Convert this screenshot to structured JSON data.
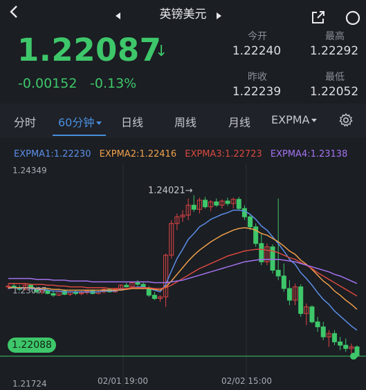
{
  "header": {
    "title": "英镑美元"
  },
  "quote": {
    "price": "1.22087",
    "arrow": "↓",
    "change": "-0.00152",
    "change_pct": "-0.13%"
  },
  "stats": {
    "open_label": "今开",
    "open_value": "1.22240",
    "high_label": "最高",
    "high_value": "1.22292",
    "prev_close_label": "昨收",
    "prev_close_value": "1.22239",
    "low_label": "最低",
    "low_value": "1.22052"
  },
  "tabs": {
    "t1": "分时",
    "t2": "60分钟",
    "t3": "日线",
    "t4": "周线",
    "t5": "月线",
    "t6": "EXPMA"
  },
  "legend": {
    "e1": "EXPMA1:1.22230",
    "e2": "EXPMA2:1.22416",
    "e3": "EXPMA3:1.22723",
    "e4": "EXPMA4:1.23138"
  },
  "axis": {
    "y_top": "1.24349",
    "y_mid": "1.23037",
    "y_bottom": "1.21724",
    "x1": "02/01 19:00",
    "x2": "02/02 15:00",
    "current": "1.22088",
    "high_annotation": "1.24021→"
  },
  "colors": {
    "up": "#e04545",
    "down": "#3ec76a",
    "ema1": "#5c8fe8",
    "ema2": "#f0a04b",
    "ema3": "#d9493f",
    "ema4": "#a473f0"
  },
  "chart_data": {
    "type": "candlestick",
    "ylim": [
      1.21724,
      1.24349
    ],
    "candles": [
      [
        1.2292,
        1.2296,
        1.2289,
        1.2293
      ],
      [
        1.2293,
        1.2297,
        1.229,
        1.2291
      ],
      [
        1.2291,
        1.2294,
        1.2287,
        1.2289
      ],
      [
        1.2289,
        1.2295,
        1.2288,
        1.2294
      ],
      [
        1.2294,
        1.2296,
        1.2289,
        1.229
      ],
      [
        1.229,
        1.2292,
        1.2285,
        1.2286
      ],
      [
        1.2286,
        1.229,
        1.2283,
        1.2288
      ],
      [
        1.2288,
        1.229,
        1.2283,
        1.2284
      ],
      [
        1.2284,
        1.2287,
        1.228,
        1.2282
      ],
      [
        1.2282,
        1.2288,
        1.2281,
        1.2287
      ],
      [
        1.2287,
        1.2289,
        1.2282,
        1.2283
      ],
      [
        1.2283,
        1.2287,
        1.2281,
        1.2286
      ],
      [
        1.2286,
        1.2288,
        1.2282,
        1.2284
      ],
      [
        1.2284,
        1.2287,
        1.2282,
        1.2285
      ],
      [
        1.2285,
        1.2288,
        1.2283,
        1.2287
      ],
      [
        1.2287,
        1.2289,
        1.2283,
        1.2284
      ],
      [
        1.2284,
        1.2288,
        1.2283,
        1.2286
      ],
      [
        1.2286,
        1.229,
        1.2284,
        1.2289
      ],
      [
        1.2289,
        1.229,
        1.2285,
        1.2286
      ],
      [
        1.2286,
        1.229,
        1.2285,
        1.2289
      ],
      [
        1.2289,
        1.2295,
        1.2288,
        1.2294
      ],
      [
        1.2294,
        1.2297,
        1.2291,
        1.2292
      ],
      [
        1.2292,
        1.2298,
        1.2291,
        1.2297
      ],
      [
        1.2297,
        1.23,
        1.2293,
        1.2295
      ],
      [
        1.2295,
        1.2298,
        1.2289,
        1.229
      ],
      [
        1.229,
        1.2293,
        1.228,
        1.2282
      ],
      [
        1.2282,
        1.2286,
        1.2276,
        1.2278
      ],
      [
        1.2278,
        1.2282,
        1.2274,
        1.228
      ],
      [
        1.228,
        1.2332,
        1.2268,
        1.233
      ],
      [
        1.233,
        1.2372,
        1.2326,
        1.2368
      ],
      [
        1.2368,
        1.238,
        1.236,
        1.2376
      ],
      [
        1.2376,
        1.2384,
        1.237,
        1.2378
      ],
      [
        1.2378,
        1.2398,
        1.2372,
        1.239
      ],
      [
        1.239,
        1.2402,
        1.2382,
        1.2385
      ],
      [
        1.2385,
        1.2399,
        1.238,
        1.2396
      ],
      [
        1.2396,
        1.24,
        1.2386,
        1.2388
      ],
      [
        1.2388,
        1.2396,
        1.2383,
        1.2394
      ],
      [
        1.2394,
        1.2398,
        1.2388,
        1.239
      ],
      [
        1.239,
        1.2397,
        1.2386,
        1.2395
      ],
      [
        1.2395,
        1.2399,
        1.2389,
        1.2392
      ],
      [
        1.2392,
        1.2399,
        1.2386,
        1.2397
      ],
      [
        1.2397,
        1.24,
        1.2384,
        1.2386
      ],
      [
        1.2386,
        1.239,
        1.2372,
        1.2376
      ],
      [
        1.2376,
        1.2378,
        1.236,
        1.2364
      ],
      [
        1.2364,
        1.2368,
        1.234,
        1.2344
      ],
      [
        1.2344,
        1.2356,
        1.2318,
        1.2322
      ],
      [
        1.2322,
        1.2344,
        1.2318,
        1.234
      ],
      [
        1.234,
        1.2343,
        1.2308,
        1.2312
      ],
      [
        1.2312,
        1.2398,
        1.23,
        1.2305
      ],
      [
        1.2305,
        1.232,
        1.2286,
        1.229
      ],
      [
        1.229,
        1.23,
        1.227,
        1.2276
      ],
      [
        1.2276,
        1.2296,
        1.227,
        1.2292
      ],
      [
        1.2292,
        1.2295,
        1.2256,
        1.226
      ],
      [
        1.226,
        1.2272,
        1.2246,
        1.2268
      ],
      [
        1.2268,
        1.227,
        1.2248,
        1.225
      ],
      [
        1.225,
        1.2256,
        1.2238,
        1.2244
      ],
      [
        1.2244,
        1.225,
        1.2228,
        1.2232
      ],
      [
        1.2232,
        1.224,
        1.222,
        1.2236
      ],
      [
        1.2236,
        1.224,
        1.2222,
        1.2226
      ],
      [
        1.2226,
        1.2232,
        1.2216,
        1.2222
      ],
      [
        1.2222,
        1.223,
        1.2214,
        1.2218
      ],
      [
        1.2218,
        1.2224,
        1.2212,
        1.222
      ],
      [
        1.222,
        1.2222,
        1.2207,
        1.2209
      ]
    ],
    "x_labels": [
      "02/01 19:00",
      "02/02 15:00"
    ],
    "series": [
      {
        "name": "EXPMA1",
        "values": [
          1.229,
          1.2291,
          1.229,
          1.2291,
          1.229,
          1.2289,
          1.2289,
          1.2288,
          1.2287,
          1.2287,
          1.2286,
          1.2286,
          1.2286,
          1.2286,
          1.2286,
          1.2286,
          1.2286,
          1.2287,
          1.2287,
          1.2287,
          1.2289,
          1.2289,
          1.2291,
          1.2292,
          1.2292,
          1.229,
          1.2288,
          1.2286,
          1.2295,
          1.2311,
          1.2326,
          1.2337,
          1.2349,
          1.2356,
          1.2364,
          1.2368,
          1.2373,
          1.2376,
          1.2379,
          1.2381,
          1.2384,
          1.2384,
          1.2383,
          1.2379,
          1.2373,
          1.2365,
          1.236,
          1.2352,
          1.2344,
          1.2335,
          1.2325,
          1.2319,
          1.2309,
          1.2302,
          1.2294,
          1.2285,
          1.2277,
          1.2271,
          1.2263,
          1.2257,
          1.2251,
          1.2245,
          1.224
        ]
      },
      {
        "name": "EXPMA2",
        "values": [
          1.2291,
          1.2291,
          1.2291,
          1.2291,
          1.2291,
          1.229,
          1.229,
          1.229,
          1.2289,
          1.2289,
          1.2288,
          1.2288,
          1.2288,
          1.2288,
          1.2288,
          1.2288,
          1.2288,
          1.2288,
          1.2288,
          1.2288,
          1.2288,
          1.2289,
          1.229,
          1.229,
          1.229,
          1.229,
          1.2289,
          1.2288,
          1.2292,
          1.2299,
          1.2307,
          1.2315,
          1.2323,
          1.233,
          1.2336,
          1.2341,
          1.2346,
          1.235,
          1.2354,
          1.2357,
          1.236,
          1.2362,
          1.2363,
          1.2362,
          1.236,
          1.2356,
          1.2354,
          1.235,
          1.2346,
          1.2341,
          1.2335,
          1.2331,
          1.2324,
          1.2319,
          1.2313,
          1.2306,
          1.2299,
          1.2294,
          1.2287,
          1.2282,
          1.2276,
          1.2271,
          1.2265
        ]
      },
      {
        "name": "EXPMA3",
        "values": [
          1.2296,
          1.2296,
          1.2296,
          1.2296,
          1.2295,
          1.2295,
          1.2295,
          1.2294,
          1.2294,
          1.2293,
          1.2293,
          1.2292,
          1.2292,
          1.2292,
          1.2291,
          1.2291,
          1.2291,
          1.2291,
          1.229,
          1.229,
          1.229,
          1.229,
          1.2291,
          1.2291,
          1.2291,
          1.2291,
          1.229,
          1.229,
          1.2291,
          1.2294,
          1.2298,
          1.2302,
          1.2306,
          1.231,
          1.2314,
          1.2317,
          1.232,
          1.2323,
          1.2326,
          1.2329,
          1.2331,
          1.2333,
          1.2335,
          1.2336,
          1.2337,
          1.2337,
          1.2336,
          1.2335,
          1.2333,
          1.233,
          1.2327,
          1.2325,
          1.2321,
          1.2318,
          1.2314,
          1.2309,
          1.2305,
          1.2301,
          1.2297,
          1.2293,
          1.2289,
          1.2285,
          1.2281
        ]
      },
      {
        "name": "EXPMA4",
        "values": [
          1.2302,
          1.2302,
          1.2302,
          1.2302,
          1.2302,
          1.2301,
          1.2301,
          1.2301,
          1.23,
          1.23,
          1.23,
          1.2299,
          1.2299,
          1.2299,
          1.2299,
          1.2298,
          1.2298,
          1.2298,
          1.2298,
          1.2298,
          1.2298,
          1.2298,
          1.2298,
          1.2298,
          1.2298,
          1.2298,
          1.2297,
          1.2297,
          1.2297,
          1.2298,
          1.2299,
          1.23,
          1.2302,
          1.2304,
          1.2306,
          1.2308,
          1.231,
          1.2312,
          1.2314,
          1.2316,
          1.2318,
          1.232,
          1.2322,
          1.2323,
          1.2324,
          1.2325,
          1.2325,
          1.2325,
          1.2325,
          1.2324,
          1.2323,
          1.2322,
          1.232,
          1.2318,
          1.2316,
          1.2314,
          1.2312,
          1.231,
          1.2307,
          1.2305,
          1.2302,
          1.2299,
          1.2296
        ]
      }
    ]
  }
}
